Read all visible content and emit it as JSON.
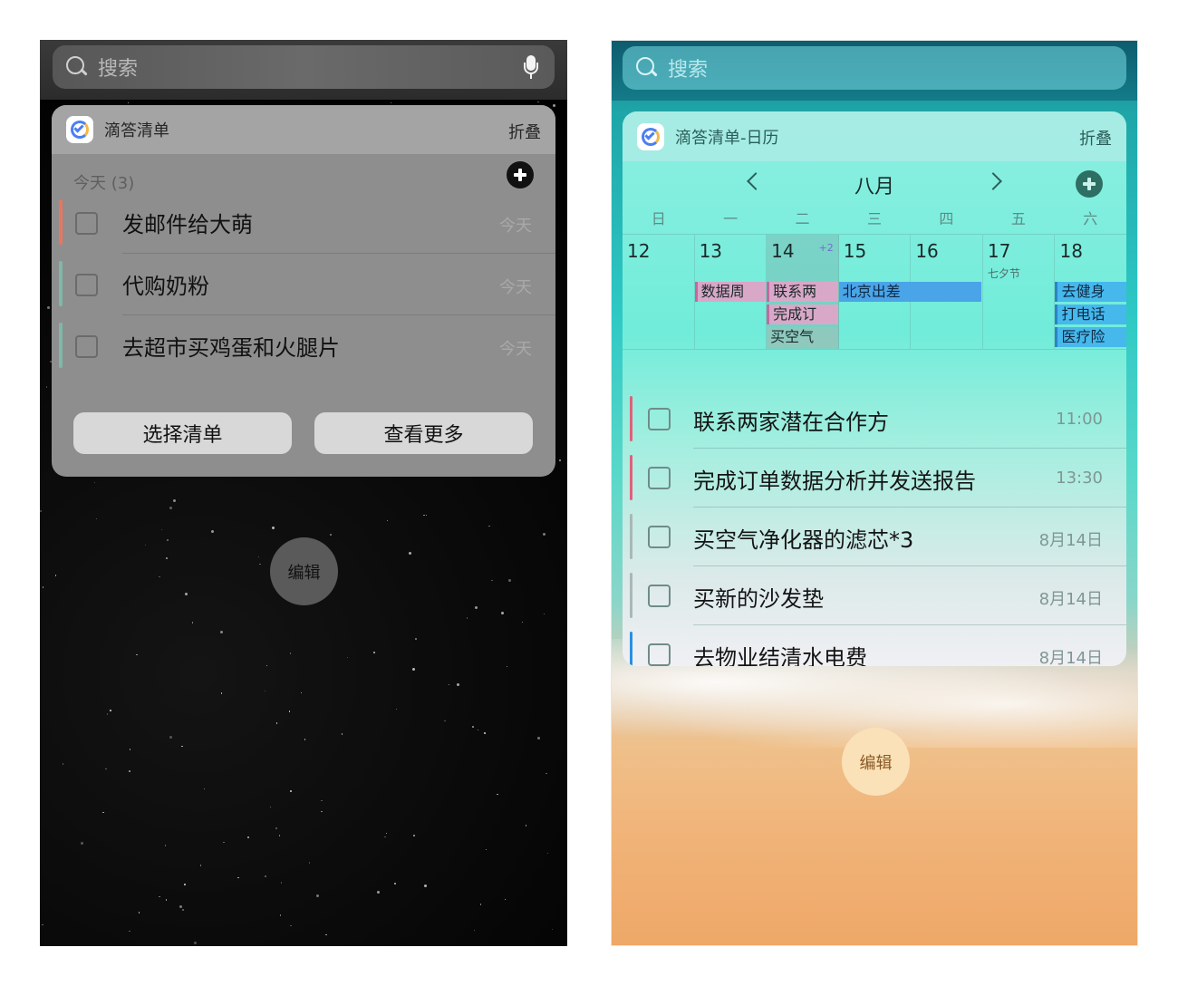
{
  "left": {
    "search": {
      "placeholder": "搜索"
    },
    "widget": {
      "title": "滴答清单",
      "fold_label": "折叠",
      "section_label": "今天 (3)",
      "tasks": [
        {
          "title": "发邮件给大萌",
          "due": "今天",
          "color": "#e8765f"
        },
        {
          "title": "代购奶粉",
          "due": "今天",
          "color": "#7fb8a8"
        },
        {
          "title": "去超市买鸡蛋和火腿片",
          "due": "今天",
          "color": "#7fb8a8"
        }
      ],
      "buttons": {
        "select_list": "选择清单",
        "view_more": "查看更多"
      }
    },
    "edit_label": "编辑"
  },
  "right": {
    "search": {
      "placeholder": "搜索"
    },
    "widget": {
      "title": "滴答清单-日历",
      "fold_label": "折叠",
      "month": "八月",
      "weekdays": [
        "日",
        "一",
        "二",
        "三",
        "四",
        "五",
        "六"
      ],
      "days": [
        {
          "num": "12"
        },
        {
          "num": "13"
        },
        {
          "num": "14",
          "more": "+2"
        },
        {
          "num": "15"
        },
        {
          "num": "16"
        },
        {
          "num": "17",
          "sub": "七夕节"
        },
        {
          "num": "18"
        }
      ],
      "events": {
        "e13": "数据周",
        "e14a": "联系两",
        "e14b": "完成订",
        "e14c": "买空气",
        "e15": "北京出差",
        "e18a": "去健身",
        "e18b": "打电话",
        "e18c": "医疗险"
      },
      "tasks": [
        {
          "title": "联系两家潜在合作方",
          "due": "11:00",
          "color": "#e0607a"
        },
        {
          "title": "完成订单数据分析并发送报告",
          "due": "13:30",
          "color": "#e0607a"
        },
        {
          "title": "买空气净化器的滤芯*3",
          "due": "8月14日",
          "color": "#a9b8b4"
        },
        {
          "title": "买新的沙发垫",
          "due": "8月14日",
          "color": "#a9b8b4"
        },
        {
          "title": "去物业结清水电费",
          "due": "8月14日",
          "color": "#2a8fe0"
        }
      ]
    },
    "edit_label": "编辑"
  }
}
